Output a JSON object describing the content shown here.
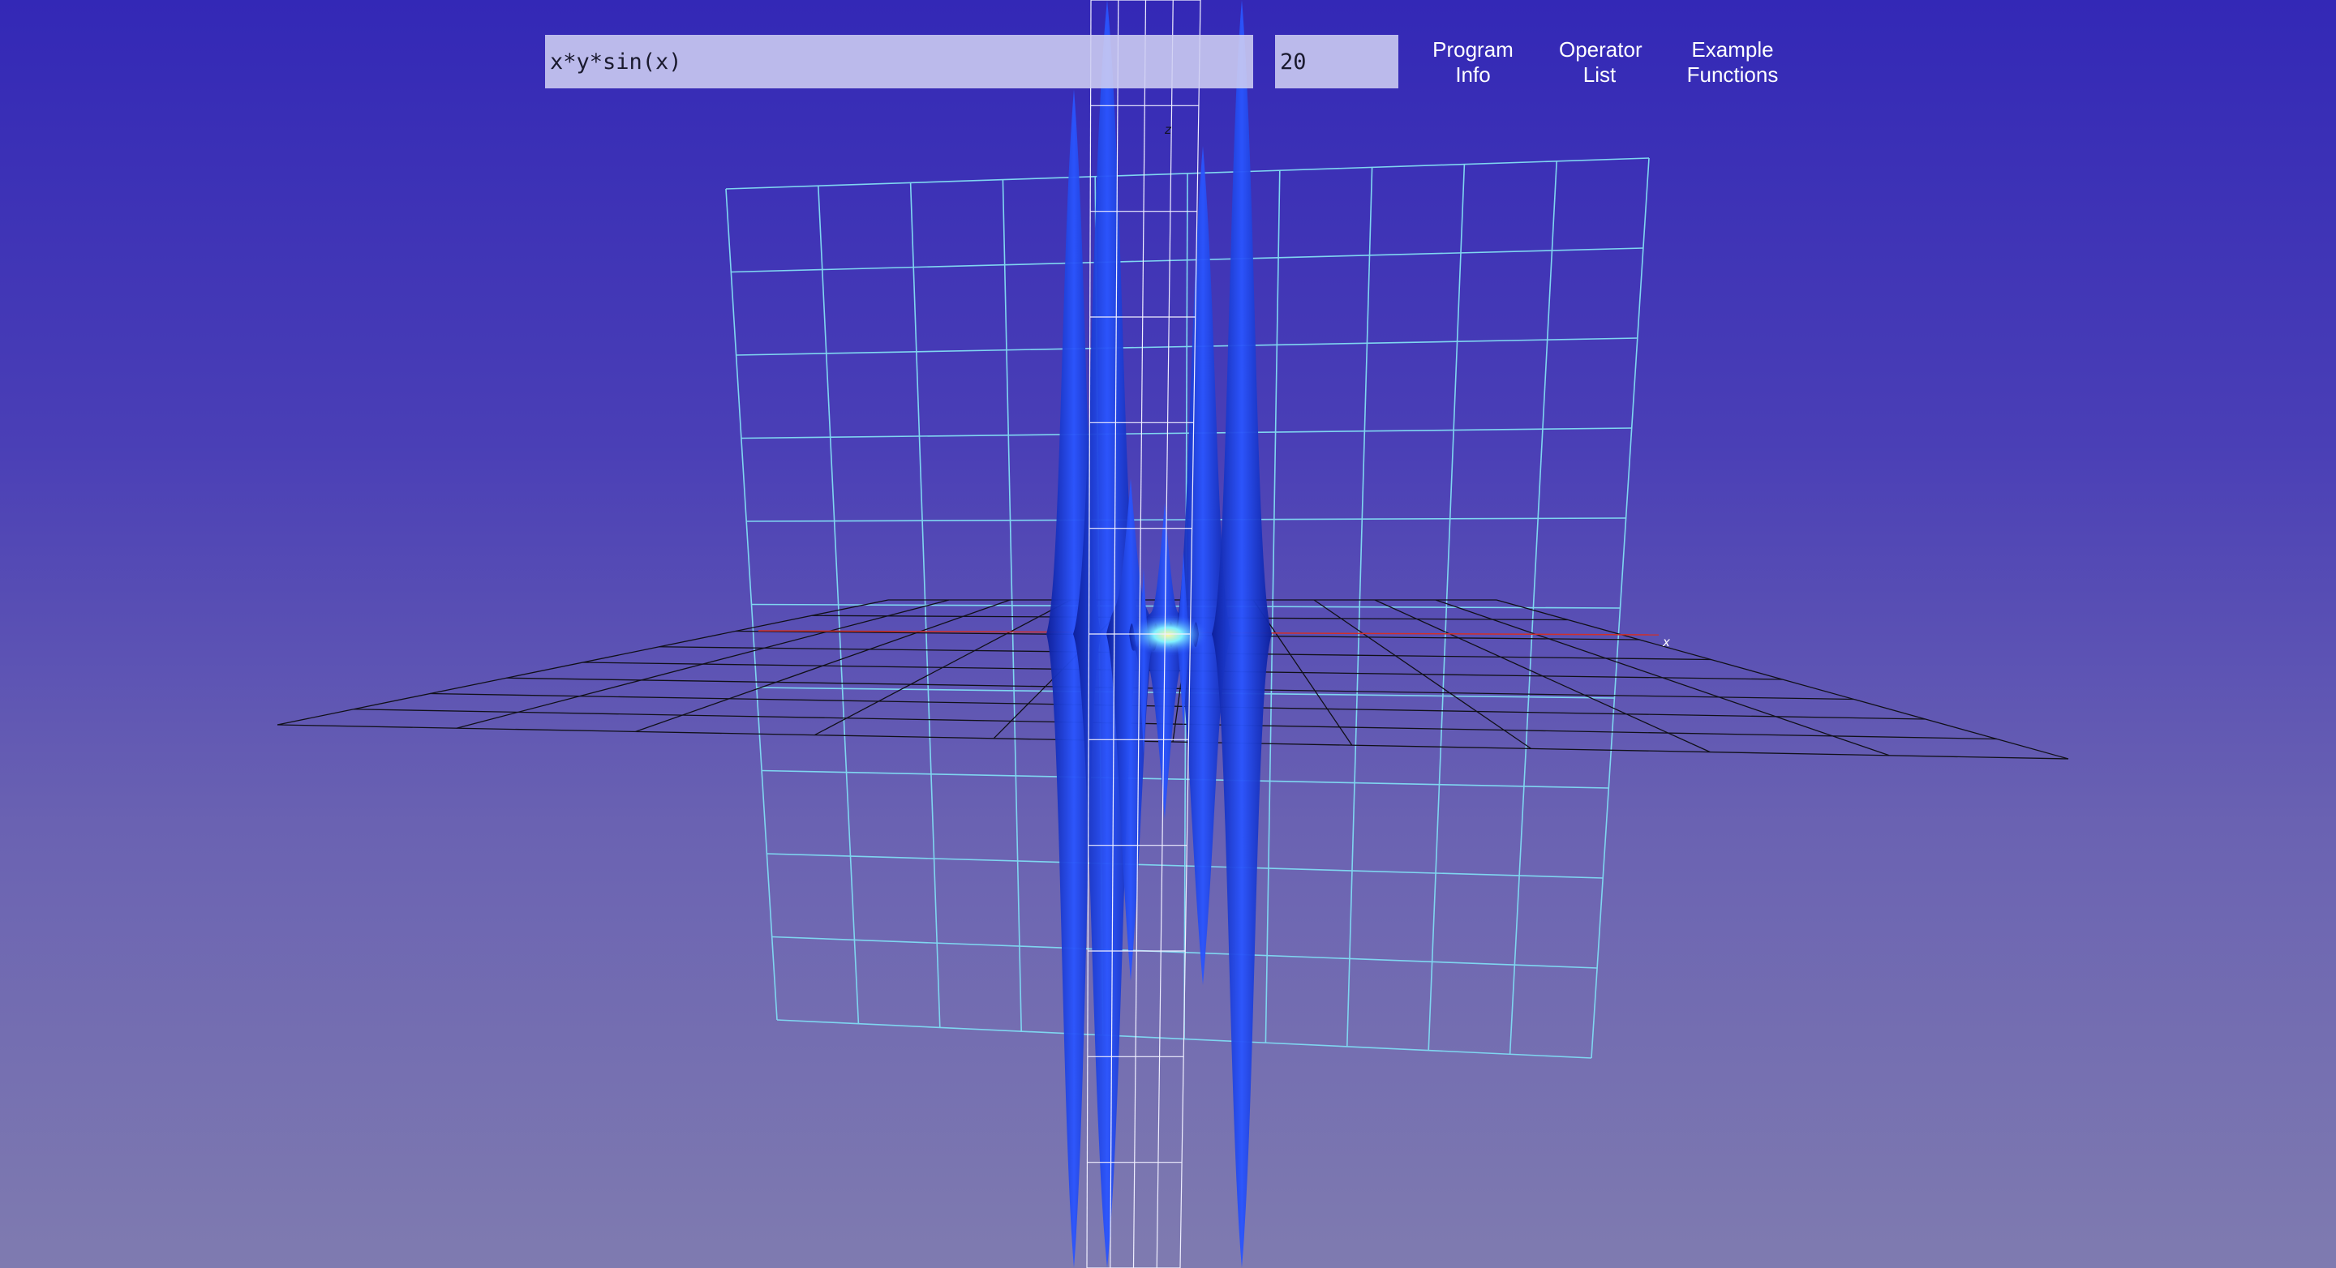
{
  "function_input": {
    "value": "x*y*sin(x)"
  },
  "resolution_input": {
    "value": "20"
  },
  "menu": {
    "program_info": [
      "Program",
      "Info"
    ],
    "operator_list": [
      "Operator",
      "List"
    ],
    "example_functions": [
      "Example",
      "Functions"
    ]
  },
  "axes": {
    "x_label": "x",
    "z_label": "z"
  },
  "colors": {
    "background_top": "#3328b6",
    "background_bottom": "#7f7bb0",
    "vertical_grid": "#7fd6f0",
    "floor_grid": "#101018",
    "surface": "#1a3cdc",
    "x_axis": "#d0302a"
  }
}
